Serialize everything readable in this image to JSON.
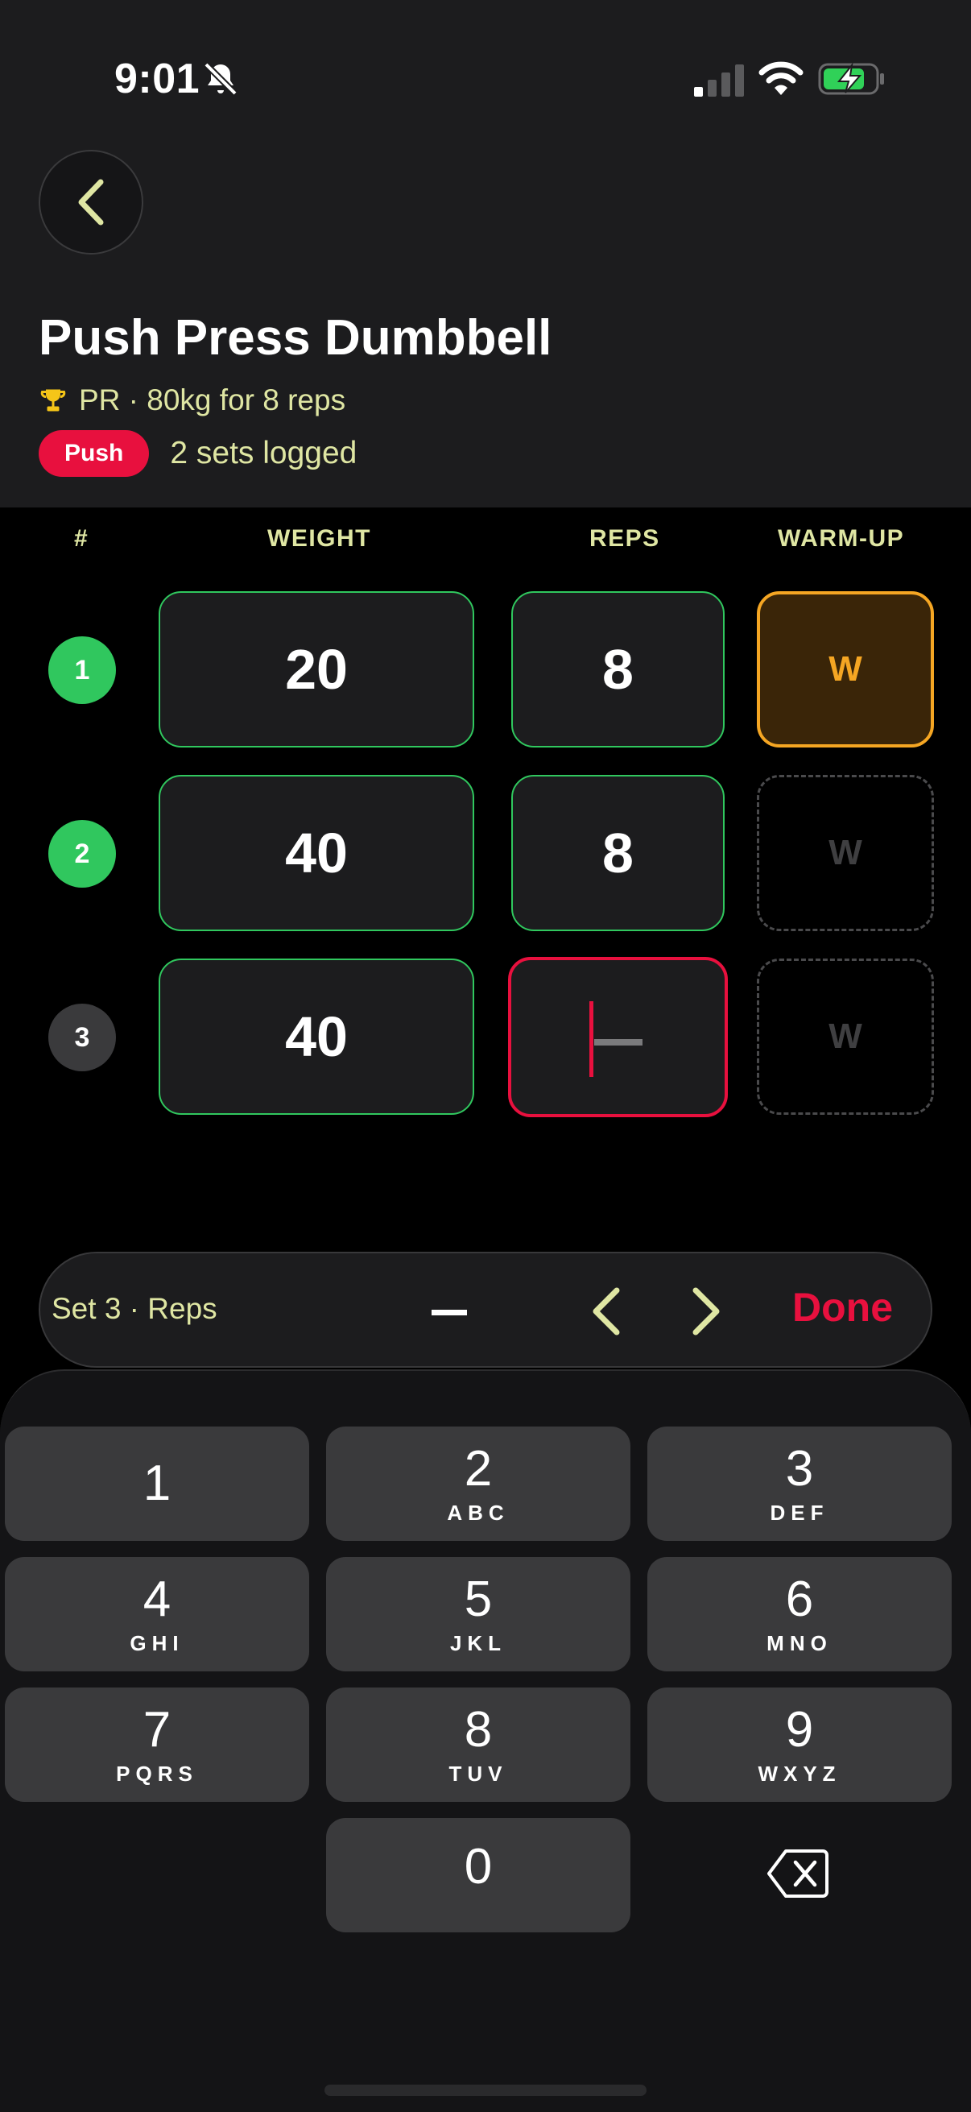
{
  "status_bar": {
    "time": "9:01",
    "icons": [
      "bell-slash-icon",
      "cellular-signal-icon",
      "wifi-icon",
      "battery-charging-icon"
    ]
  },
  "header": {
    "back_icon": "chevron-left-icon",
    "title": "Push Press Dumbbell",
    "pr_icon": "trophy-icon",
    "pr_text": "PR · 80kg for 8 reps",
    "tag": "Push",
    "sets_logged": "2 sets logged"
  },
  "table": {
    "columns": [
      "#",
      "WEIGHT",
      "REPS",
      "WARM-UP"
    ],
    "rows": [
      {
        "num": "1",
        "weight": "20",
        "reps": "8",
        "warmup": "W",
        "warmup_active": true,
        "completed": true
      },
      {
        "num": "2",
        "weight": "40",
        "reps": "8",
        "warmup": "W",
        "warmup_active": false,
        "completed": true
      },
      {
        "num": "3",
        "weight": "40",
        "reps": "",
        "warmup": "W",
        "warmup_active": false,
        "completed": false
      }
    ]
  },
  "input_bar": {
    "label": "Set 3 · Reps",
    "prev_icon": "chevron-left-icon",
    "next_icon": "chevron-right-icon",
    "done_label": "Done"
  },
  "keypad": {
    "keys": [
      {
        "digit": "1",
        "letters": ""
      },
      {
        "digit": "2",
        "letters": "ABC"
      },
      {
        "digit": "3",
        "letters": "DEF"
      },
      {
        "digit": "4",
        "letters": "GHI"
      },
      {
        "digit": "5",
        "letters": "JKL"
      },
      {
        "digit": "6",
        "letters": "MNO"
      },
      {
        "digit": "7",
        "letters": "PQRS"
      },
      {
        "digit": "8",
        "letters": "TUV"
      },
      {
        "digit": "9",
        "letters": "WXYZ"
      },
      {
        "digit": "0",
        "letters": ""
      }
    ],
    "delete_icon": "backspace-icon"
  },
  "colors": {
    "accent_yellow": "#dfe6a3",
    "complete_green": "#30c75e",
    "active_red": "#e8103e",
    "warmup_orange": "#f5a623"
  }
}
